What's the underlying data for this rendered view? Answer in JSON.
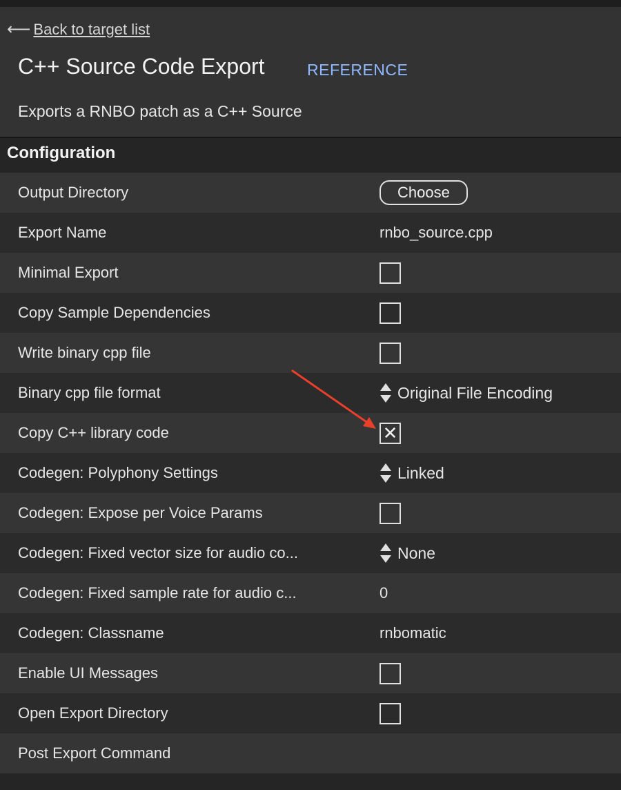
{
  "header": {
    "back_label": "Back to target list",
    "title": "C++ Source Code Export",
    "reference_label": "REFERENCE",
    "description": "Exports a RNBO patch as a C++ Source"
  },
  "section": {
    "title": "Configuration"
  },
  "rows": [
    {
      "label": "Output Directory",
      "control": "button",
      "value": "Choose"
    },
    {
      "label": "Export Name",
      "control": "text",
      "value": "rnbo_source.cpp"
    },
    {
      "label": "Minimal Export",
      "control": "checkbox",
      "checked": false
    },
    {
      "label": "Copy Sample Dependencies",
      "control": "checkbox",
      "checked": false
    },
    {
      "label": "Write binary cpp file",
      "control": "checkbox",
      "checked": false
    },
    {
      "label": "Binary cpp file format",
      "control": "select",
      "value": "Original File Encoding"
    },
    {
      "label": "Copy C++ library code",
      "control": "checkbox",
      "checked": true,
      "check_glyph": "✕"
    },
    {
      "label": "Codegen: Polyphony Settings",
      "control": "select",
      "value": "Linked"
    },
    {
      "label": "Codegen: Expose per Voice Params",
      "control": "checkbox",
      "checked": false
    },
    {
      "label": "Codegen: Fixed vector size for audio co...",
      "control": "select",
      "value": "None"
    },
    {
      "label": "Codegen: Fixed sample rate for audio c...",
      "control": "text",
      "value": "0"
    },
    {
      "label": "Codegen: Classname",
      "control": "text",
      "value": "rnbomatic"
    },
    {
      "label": "Enable UI Messages",
      "control": "checkbox",
      "checked": false
    },
    {
      "label": "Open Export Directory",
      "control": "checkbox",
      "checked": false
    },
    {
      "label": "Post Export Command",
      "control": "text",
      "value": ""
    }
  ],
  "icons": {
    "back": "arrow-left-icon",
    "select": "up-down-chevron-icon",
    "annotation": "red-arrow-annotation"
  },
  "colors": {
    "reference_link": "#8fb8ff",
    "annotation_arrow": "#e8402a"
  }
}
